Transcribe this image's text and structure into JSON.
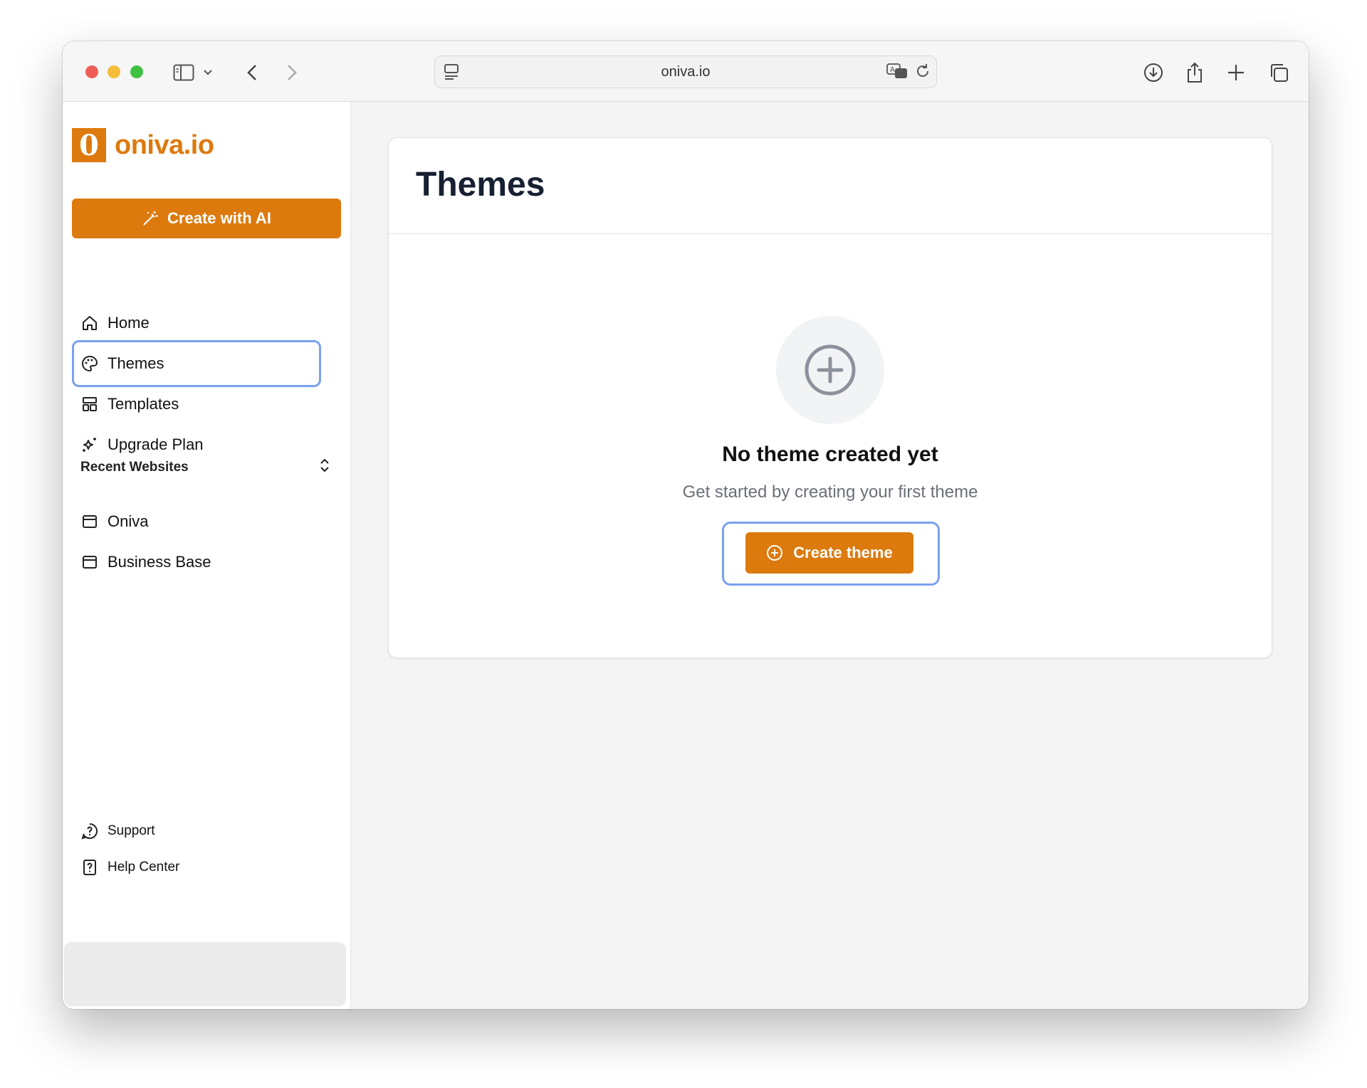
{
  "browser": {
    "url": "oniva.io"
  },
  "sidebar": {
    "logo_mark": "0",
    "logo_text": "oniva.io",
    "create_ai_label": "Create with AI",
    "nav": [
      {
        "label": "Home",
        "icon": "home-icon"
      },
      {
        "label": "Themes",
        "icon": "palette-icon",
        "active": true
      },
      {
        "label": "Templates",
        "icon": "layout-icon"
      },
      {
        "label": "Upgrade Plan",
        "icon": "sparkles-icon"
      }
    ],
    "recent_title": "Recent Websites",
    "recent": [
      {
        "label": "Oniva",
        "icon": "browser-window-icon"
      },
      {
        "label": "Business Base",
        "icon": "browser-window-icon"
      }
    ],
    "footer": [
      {
        "label": "Support",
        "icon": "help-circle-icon"
      },
      {
        "label": "Help Center",
        "icon": "help-document-icon"
      }
    ]
  },
  "main": {
    "title": "Themes",
    "empty_title": "No theme created yet",
    "empty_subtitle": "Get started by creating your first theme",
    "create_button": "Create theme"
  },
  "colors": {
    "accent": "#dd7a0e",
    "focus_ring": "#7aa1ee",
    "title_text": "#172032"
  }
}
